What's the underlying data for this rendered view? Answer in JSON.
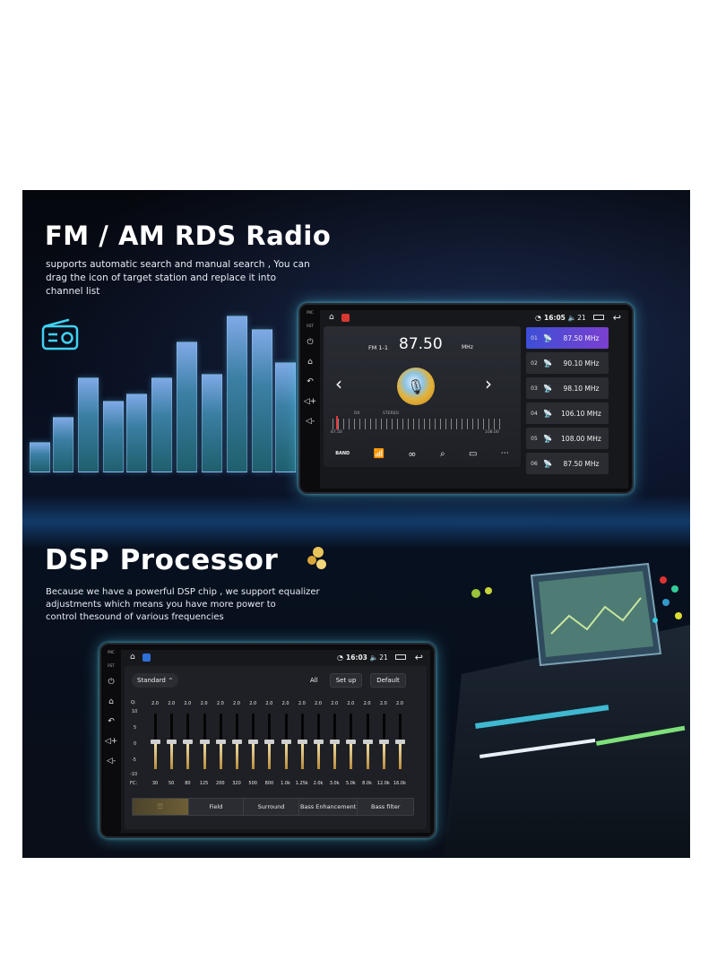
{
  "fm_section": {
    "title": "FM / AM RDS Radio",
    "description_lines": [
      "supports automatic search and manual search , You can",
      "drag the icon of target station and replace it into",
      "channel list"
    ]
  },
  "radio_screen": {
    "status": {
      "time": "16:05",
      "volume": "21"
    },
    "band_label": "FM 1-1",
    "frequency": "87.50",
    "unit": "MHz",
    "dx_label": "DX",
    "stereo_label": "STEREO",
    "scale_min": "87.50",
    "scale_max": "108.00",
    "presets": [
      {
        "num": "01",
        "freq": "87.50 MHz",
        "active": true
      },
      {
        "num": "02",
        "freq": "90.10 MHz",
        "active": false
      },
      {
        "num": "03",
        "freq": "98.10 MHz",
        "active": false
      },
      {
        "num": "04",
        "freq": "106.10 MHz",
        "active": false
      },
      {
        "num": "05",
        "freq": "108.00 MHz",
        "active": false
      },
      {
        "num": "06",
        "freq": "87.50 MHz",
        "active": false
      }
    ],
    "bottom_icons": [
      "band-icon",
      "antenna-icon",
      "stereo-icon",
      "scan-icon",
      "save-icon",
      "more-icon"
    ],
    "band_button_label": "BAND"
  },
  "dsp_section": {
    "title": "DSP Processor",
    "description_lines": [
      "Because we have a powerful DSP chip , we support equalizer",
      "adjustments which means you have more power to",
      "control thesound of various frequencies"
    ]
  },
  "eq_screen": {
    "status": {
      "time": "16:03",
      "volume": "21"
    },
    "preset_select": "Standard",
    "all_label": "All",
    "setup_label": "Set up",
    "default_label": "Default",
    "q_label": "Q:",
    "fc_label": "FC:",
    "scale": [
      "10",
      "5",
      "0",
      "-5",
      "-10"
    ],
    "bands": [
      {
        "q": "2.0",
        "fc": "30"
      },
      {
        "q": "2.0",
        "fc": "50"
      },
      {
        "q": "2.0",
        "fc": "80"
      },
      {
        "q": "2.0",
        "fc": "125"
      },
      {
        "q": "2.0",
        "fc": "200"
      },
      {
        "q": "2.0",
        "fc": "320"
      },
      {
        "q": "2.0",
        "fc": "500"
      },
      {
        "q": "2.0",
        "fc": "800"
      },
      {
        "q": "2.0",
        "fc": "1.0k"
      },
      {
        "q": "2.0",
        "fc": "1.25k"
      },
      {
        "q": "2.0",
        "fc": "2.0k"
      },
      {
        "q": "2.0",
        "fc": "3.0k"
      },
      {
        "q": "2.0",
        "fc": "5.0k"
      },
      {
        "q": "2.0",
        "fc": "8.0k"
      },
      {
        "q": "2.0",
        "fc": "12.0k"
      },
      {
        "q": "2.0",
        "fc": "16.0k"
      }
    ],
    "tabs": [
      "Field",
      "Surround",
      "Bass Enhancement",
      "Bass filter"
    ]
  },
  "colors": {
    "preset_active_start": "#3d4fd6",
    "preset_active_end": "#7b3fd0",
    "unit_glow": "#50dcff",
    "eq_fill": "#d9b870"
  }
}
